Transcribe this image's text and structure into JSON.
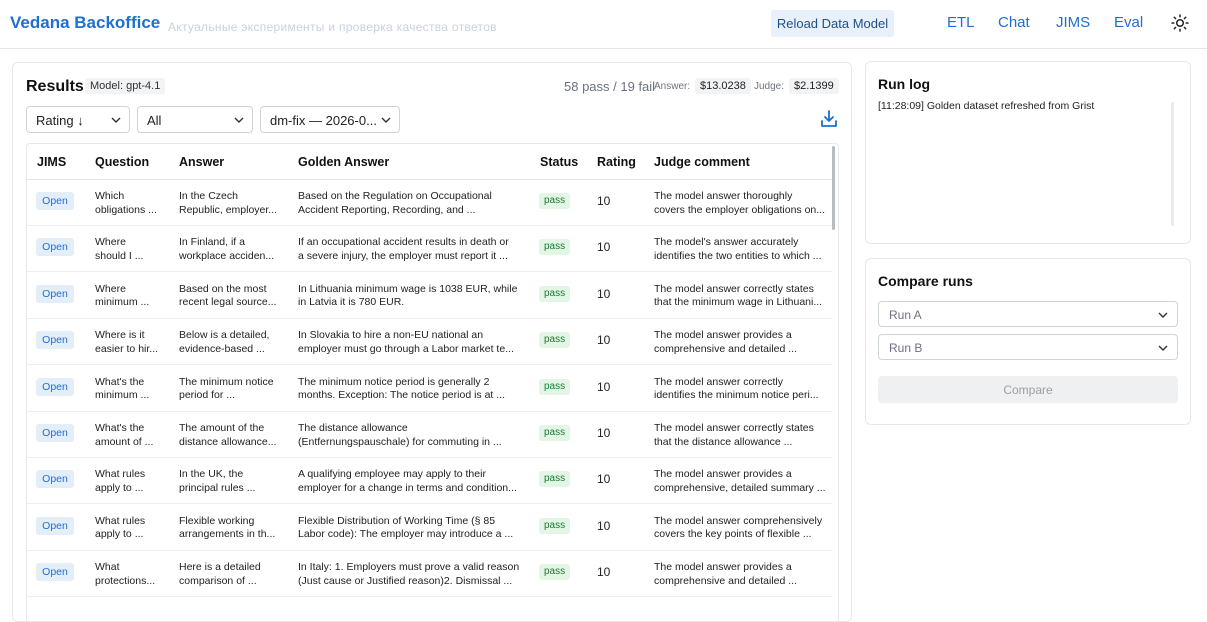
{
  "header": {
    "brand": "Vedana Backoffice",
    "brand_sub": "Актуальные эксперименты и проверка качества ответов",
    "reload_label": "Reload Data Model",
    "nav": [
      "ETL",
      "Chat",
      "JIMS",
      "Eval"
    ]
  },
  "results": {
    "title": "Results",
    "model": "Model: gpt-4.1",
    "summary": "58 pass / 19 fail",
    "answer_label": "Answer:",
    "answer_cost": "$13.0238",
    "judge_label": "Judge:",
    "judge_cost": "$2.1399",
    "filters": {
      "sort": "Rating ↓",
      "status": "All",
      "run": "dm-fix — 2026-0..."
    },
    "columns": [
      "JIMS",
      "Question",
      "Answer",
      "Golden Answer",
      "Status",
      "Rating",
      "Judge comment"
    ],
    "open_label": "Open",
    "rows": [
      {
        "q1": "Which",
        "q2": "obligations ...",
        "a1": "In the Czech",
        "a2": "Republic, employer...",
        "g1": "Based on the Regulation on Occupational",
        "g2": "Accident Reporting, Recording, and ...",
        "status": "pass",
        "rating": "10",
        "j1": "The model answer thoroughly",
        "j2": "covers the employer obligations on..."
      },
      {
        "q1": "Where",
        "q2": "should I ...",
        "a1": "In Finland, if a",
        "a2": "workplace acciden...",
        "g1": "If an occupational accident results in death or",
        "g2": "a severe injury, the employer must report it ...",
        "status": "pass",
        "rating": "10",
        "j1": "The model's answer accurately",
        "j2": "identifies the two entities to which ..."
      },
      {
        "q1": "Where",
        "q2": "minimum ...",
        "a1": "Based on the most",
        "a2": "recent legal source...",
        "g1": "In Lithuania minimum wage is 1038 EUR, while",
        "g2": "in Latvia it is 780 EUR.",
        "status": "pass",
        "rating": "10",
        "j1": "The model answer correctly states",
        "j2": "that the minimum wage in Lithuani..."
      },
      {
        "q1": "Where is it",
        "q2": "easier to hir...",
        "a1": "Below is a detailed,",
        "a2": "evidence-based ...",
        "g1": "In Slovakia to hire a non-EU national an",
        "g2": "employer must go through a Labor market te...",
        "status": "pass",
        "rating": "10",
        "j1": "The model answer provides a",
        "j2": "comprehensive and detailed ..."
      },
      {
        "q1": "What's the",
        "q2": "minimum ...",
        "a1": "The minimum notice",
        "a2": "period for ...",
        "g1": "The minimum notice period is generally 2",
        "g2": "months. Exception: The notice period is at ...",
        "status": "pass",
        "rating": "10",
        "j1": "The model answer correctly",
        "j2": "identifies the minimum notice peri..."
      },
      {
        "q1": "What's the",
        "q2": "amount of ...",
        "a1": "The amount of the",
        "a2": "distance allowance...",
        "g1": "The distance allowance",
        "g2": "(Entfernungspauschale) for commuting in ...",
        "status": "pass",
        "rating": "10",
        "j1": "The model answer correctly states",
        "j2": "that the distance allowance ..."
      },
      {
        "q1": "What rules",
        "q2": "apply to ...",
        "a1": "In the UK, the",
        "a2": "principal rules ...",
        "g1": "A qualifying employee may apply to their",
        "g2": "employer for a change in terms and condition...",
        "status": "pass",
        "rating": "10",
        "j1": "The model answer provides a",
        "j2": "comprehensive, detailed summary ..."
      },
      {
        "q1": "What rules",
        "q2": "apply to ...",
        "a1": "Flexible working",
        "a2": "arrangements in th...",
        "g1": "Flexible Distribution of Working Time (§ 85",
        "g2": "Labor code): The employer may introduce a ...",
        "status": "pass",
        "rating": "10",
        "j1": "The model answer comprehensively",
        "j2": "covers the key points of flexible ..."
      },
      {
        "q1": "What",
        "q2": "protections...",
        "a1": "Here is a detailed",
        "a2": "comparison of ...",
        "g1": "In Italy: 1. Employers must prove a valid reason",
        "g2": "(Just cause or Justified reason)2. Dismissal ...",
        "status": "pass",
        "rating": "10",
        "j1": "The model answer provides a",
        "j2": "comprehensive and detailed ..."
      }
    ]
  },
  "run_log": {
    "title": "Run log",
    "lines": [
      "[11:28:09] Golden dataset refreshed from Grist"
    ]
  },
  "compare": {
    "title": "Compare runs",
    "run_a": "Run A",
    "run_b": "Run B",
    "button": "Compare"
  }
}
